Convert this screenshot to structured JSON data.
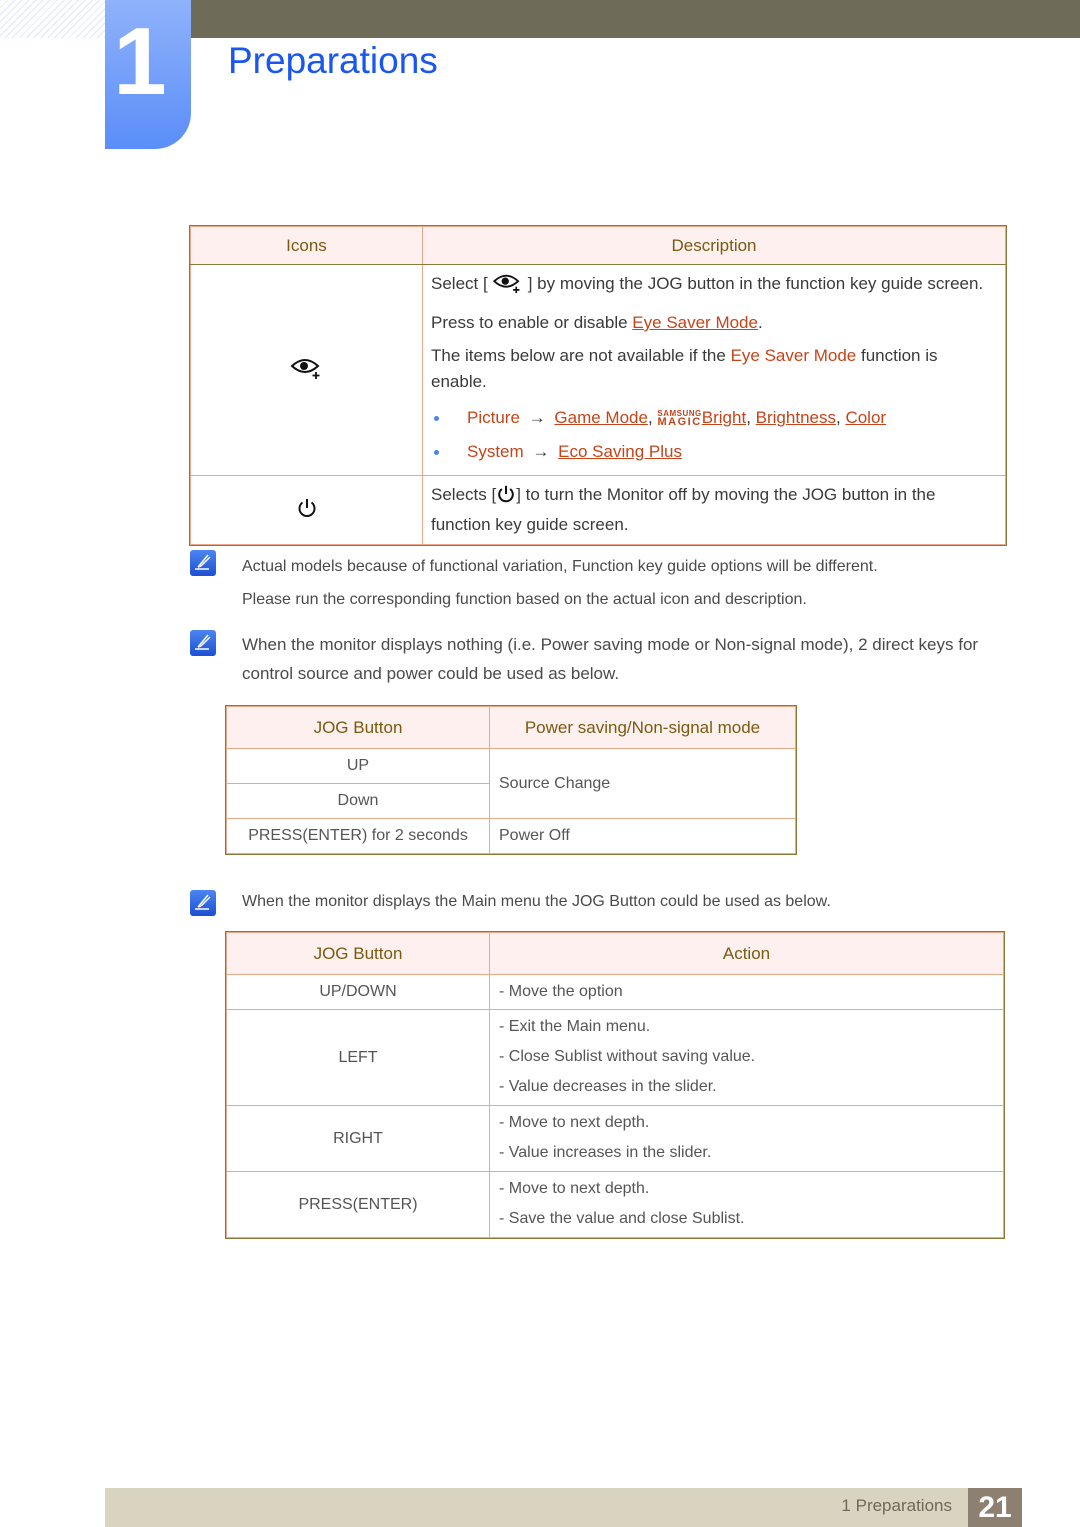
{
  "header": {
    "chapter_number": "1",
    "chapter_title": "Preparations"
  },
  "icons_table": {
    "headers": [
      "Icons",
      "Description"
    ],
    "rows": [
      {
        "icon": "eye-saver-icon",
        "select_prefix": "Select [",
        "select_suffix": "] by moving the JOG button in the function key guide screen.",
        "press_prefix": "Press to enable or disable ",
        "press_link": "Eye Saver Mode",
        "press_suffix": ".",
        "items_prefix": "The items below are not available if the ",
        "items_highlight": "Eye Saver Mode",
        "items_suffix": " function is enable.",
        "bullets": [
          {
            "menu": "Picture",
            "arrow": "→",
            "links": [
              "Game Mode",
              "Bright",
              "Brightness",
              "Color"
            ],
            "magic_top": "SAMSUNG",
            "magic_bottom": "MAGIC"
          },
          {
            "menu": "System",
            "arrow": "→",
            "links": [
              "Eco Saving Plus"
            ]
          }
        ]
      },
      {
        "icon": "power-icon",
        "text_prefix": "Selects [",
        "text_suffix": "] to turn the Monitor off by moving the JOG button in the function key guide screen."
      }
    ]
  },
  "notes": [
    {
      "lines": [
        "Actual models because of functional variation, Function key guide options will be different.",
        "Please run the corresponding function based on the actual icon and description."
      ]
    },
    {
      "text": "When the monitor displays nothing (i.e. Power saving mode or Non-signal mode), 2 direct keys for control source and power could be used as below."
    },
    {
      "text": "When the monitor displays the Main menu the JOG Button could be used as below."
    }
  ],
  "power_saving_table": {
    "headers": [
      "JOG Button",
      "Power saving/Non-signal mode"
    ],
    "rows": [
      {
        "button": "UP",
        "action": "Source Change"
      },
      {
        "button": "Down",
        "action": "Source Change"
      },
      {
        "button": "PRESS(ENTER) for 2 seconds",
        "action": "Power Off"
      }
    ]
  },
  "main_menu_table": {
    "headers": [
      "JOG Button",
      "Action"
    ],
    "rows": [
      {
        "button": "UP/DOWN",
        "actions": [
          "- Move the option"
        ]
      },
      {
        "button": "LEFT",
        "actions": [
          "- Exit the Main menu.",
          "- Close Sublist without saving value.",
          "- Value decreases in the slider."
        ]
      },
      {
        "button": "RIGHT",
        "actions": [
          "- Move to next depth.",
          "- Value increases in the slider."
        ]
      },
      {
        "button": "PRESS(ENTER)",
        "actions": [
          "- Move to next depth.",
          "- Save the value and close Sublist."
        ]
      }
    ]
  },
  "footer": {
    "section_label": "1 Preparations",
    "page_number": "21"
  },
  "colors": {
    "title_blue": "#1a56f0",
    "link_orange": "#c6441a",
    "header_brown": "#7a5a10",
    "top_bar": "#6e6b59",
    "footer_bar": "#d9d4bf",
    "page_badge": "#8d8070"
  }
}
